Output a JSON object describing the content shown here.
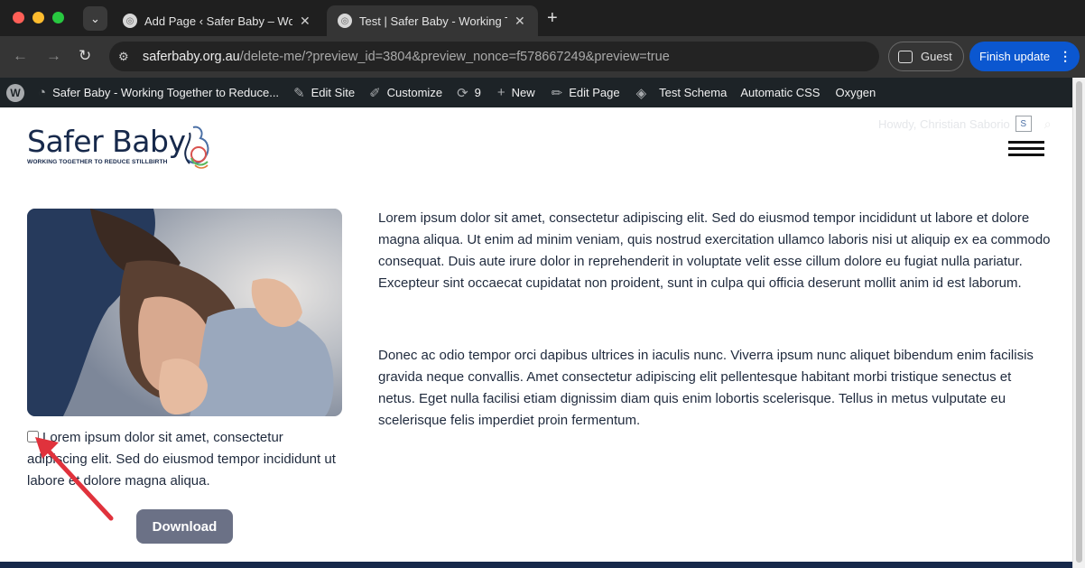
{
  "browser": {
    "tabs": [
      {
        "title": "Add Page ‹ Safer Baby – Working Together to Reduce Stillbirth — WordPress",
        "active": false
      },
      {
        "title": "Test | Safer Baby - Working Together to Reduce Stillbirth",
        "active": true
      }
    ],
    "new_tab_glyph": "+",
    "close_glyph": "✕",
    "url_host": "saferbaby.org.au",
    "url_path": "/delete-me/?preview_id=3804&preview_nonce=f578667249&preview=true",
    "profile_label": "Guest",
    "update_label": "Finish update"
  },
  "admin_bar": {
    "site_name": "Safer Baby - Working Together to Reduce...",
    "edit_site": "Edit Site",
    "customize": "Customize",
    "updates_count": "9",
    "new": "New",
    "edit_page": "Edit Page",
    "test_schema": "Test Schema",
    "automatic_css": "Automatic CSS",
    "oxygen": "Oxygen",
    "howdy": "Howdy, Christian Saborio"
  },
  "site": {
    "logo_text": "Safer Baby",
    "logo_tagline": "WORKING TOGETHER TO REDUCE STILLBIRTH"
  },
  "content": {
    "caption": "Lorem ipsum dolor sit amet, consectetur adipiscing elit. Sed do eiusmod tempor incididunt ut labore et dolore magna aliqua.",
    "download_label": "Download",
    "paragraph1": "Lorem ipsum dolor sit amet, consectetur adipiscing elit. Sed do eiusmod tempor incididunt ut labore et dolore magna aliqua. Ut enim ad minim veniam, quis nostrud exercitation ullamco laboris nisi ut aliquip ex ea commodo consequat. Duis aute irure dolor in reprehenderit in voluptate velit esse cillum dolore eu fugiat nulla pariatur. Excepteur sint occaecat cupidatat non proident, sunt in culpa qui officia deserunt mollit anim id est laborum.",
    "paragraph2": "Donec ac odio tempor orci dapibus ultrices in iaculis nunc. Viverra ipsum nunc aliquet bibendum enim facilisis gravida neque convallis. Amet consectetur adipiscing elit pellentesque habitant morbi tristique senectus et netus. Eget nulla facilisi etiam dignissim diam quis enim lobortis scelerisque. Tellus in metus vulputate eu scelerisque felis imperdiet proin fermentum."
  },
  "colors": {
    "brand_navy": "#17294b",
    "button_grey": "#6b7186",
    "annotation_arrow": "#e0323c",
    "chrome_accent": "#0b57d0"
  }
}
